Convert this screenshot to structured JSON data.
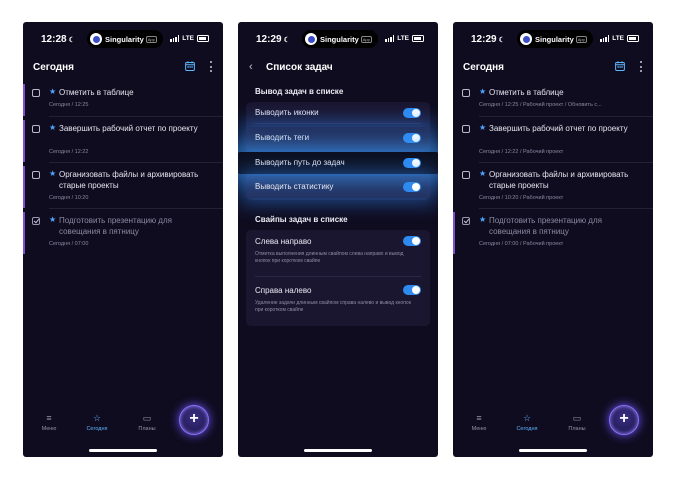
{
  "status": {
    "time1": "12:28",
    "time2": "12:29",
    "time3": "12:29",
    "app_name": "Singularity",
    "app_badge": "App",
    "network": "LTE"
  },
  "today": {
    "title": "Сегодня",
    "tasks": [
      {
        "text": "Отметить в таблице",
        "meta": "Сегодня / 12:25",
        "meta_full": "Сегодня / 12:25 / Рабочий проект / Обновить с..."
      },
      {
        "text": "Завершить рабочий отчет по проекту",
        "meta": "Сегодня / 12:22",
        "meta_full": "Сегодня / 12:22 / Рабочий проект"
      },
      {
        "text": "Организовать файлы и архивировать старые проекты",
        "meta": "Сегодня / 10:20",
        "meta_full": "Сегодня / 10:20 / Рабочий проект"
      },
      {
        "text": "Подготовить презентацию для совещания в пятницу",
        "meta": "Сегодня / 07:00",
        "meta_full": "Сегодня / 07:00 / Рабочий проект"
      }
    ]
  },
  "tabbar": {
    "menu": "Меню",
    "today": "Сегодня",
    "plans": "Планы"
  },
  "settings": {
    "title": "Список задач",
    "section1": "Вывод задач в списке",
    "rows": [
      "Выводить иконки",
      "Выводить теги",
      "Выводить путь до задач",
      "Выводить статистику"
    ],
    "section2": "Свайпы задач в списке",
    "swipes": [
      {
        "label": "Слева направо",
        "desc": "Отметка выполнения длинным свайпом слева направо и вывод кнопок при коротком свайпе"
      },
      {
        "label": "Справа налево",
        "desc": "Удаление задачи длинным свайпом справа налево и вывод кнопок при коротком свайпе"
      }
    ]
  },
  "colors": {
    "background": "#0f0c1f",
    "accent": "#2f8af0",
    "star": "#4da6ff",
    "fab_ring": "#8d72ff"
  }
}
